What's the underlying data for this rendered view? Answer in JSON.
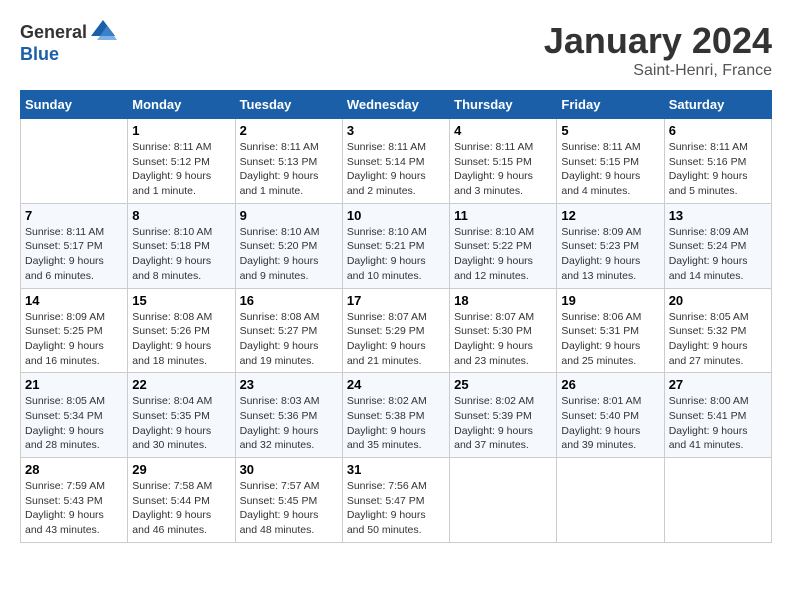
{
  "header": {
    "logo_general": "General",
    "logo_blue": "Blue",
    "month": "January 2024",
    "location": "Saint-Henri, France"
  },
  "days_of_week": [
    "Sunday",
    "Monday",
    "Tuesday",
    "Wednesday",
    "Thursday",
    "Friday",
    "Saturday"
  ],
  "weeks": [
    [
      {
        "day": "",
        "sunrise": "",
        "sunset": "",
        "daylight": ""
      },
      {
        "day": "1",
        "sunrise": "8:11 AM",
        "sunset": "5:12 PM",
        "daylight": "9 hours and 1 minute."
      },
      {
        "day": "2",
        "sunrise": "8:11 AM",
        "sunset": "5:13 PM",
        "daylight": "9 hours and 1 minute."
      },
      {
        "day": "3",
        "sunrise": "8:11 AM",
        "sunset": "5:14 PM",
        "daylight": "9 hours and 2 minutes."
      },
      {
        "day": "4",
        "sunrise": "8:11 AM",
        "sunset": "5:15 PM",
        "daylight": "9 hours and 3 minutes."
      },
      {
        "day": "5",
        "sunrise": "8:11 AM",
        "sunset": "5:15 PM",
        "daylight": "9 hours and 4 minutes."
      },
      {
        "day": "6",
        "sunrise": "8:11 AM",
        "sunset": "5:16 PM",
        "daylight": "9 hours and 5 minutes."
      }
    ],
    [
      {
        "day": "7",
        "sunrise": "8:11 AM",
        "sunset": "5:17 PM",
        "daylight": "9 hours and 6 minutes."
      },
      {
        "day": "8",
        "sunrise": "8:10 AM",
        "sunset": "5:18 PM",
        "daylight": "9 hours and 8 minutes."
      },
      {
        "day": "9",
        "sunrise": "8:10 AM",
        "sunset": "5:20 PM",
        "daylight": "9 hours and 9 minutes."
      },
      {
        "day": "10",
        "sunrise": "8:10 AM",
        "sunset": "5:21 PM",
        "daylight": "9 hours and 10 minutes."
      },
      {
        "day": "11",
        "sunrise": "8:10 AM",
        "sunset": "5:22 PM",
        "daylight": "9 hours and 12 minutes."
      },
      {
        "day": "12",
        "sunrise": "8:09 AM",
        "sunset": "5:23 PM",
        "daylight": "9 hours and 13 minutes."
      },
      {
        "day": "13",
        "sunrise": "8:09 AM",
        "sunset": "5:24 PM",
        "daylight": "9 hours and 14 minutes."
      }
    ],
    [
      {
        "day": "14",
        "sunrise": "8:09 AM",
        "sunset": "5:25 PM",
        "daylight": "9 hours and 16 minutes."
      },
      {
        "day": "15",
        "sunrise": "8:08 AM",
        "sunset": "5:26 PM",
        "daylight": "9 hours and 18 minutes."
      },
      {
        "day": "16",
        "sunrise": "8:08 AM",
        "sunset": "5:27 PM",
        "daylight": "9 hours and 19 minutes."
      },
      {
        "day": "17",
        "sunrise": "8:07 AM",
        "sunset": "5:29 PM",
        "daylight": "9 hours and 21 minutes."
      },
      {
        "day": "18",
        "sunrise": "8:07 AM",
        "sunset": "5:30 PM",
        "daylight": "9 hours and 23 minutes."
      },
      {
        "day": "19",
        "sunrise": "8:06 AM",
        "sunset": "5:31 PM",
        "daylight": "9 hours and 25 minutes."
      },
      {
        "day": "20",
        "sunrise": "8:05 AM",
        "sunset": "5:32 PM",
        "daylight": "9 hours and 27 minutes."
      }
    ],
    [
      {
        "day": "21",
        "sunrise": "8:05 AM",
        "sunset": "5:34 PM",
        "daylight": "9 hours and 28 minutes."
      },
      {
        "day": "22",
        "sunrise": "8:04 AM",
        "sunset": "5:35 PM",
        "daylight": "9 hours and 30 minutes."
      },
      {
        "day": "23",
        "sunrise": "8:03 AM",
        "sunset": "5:36 PM",
        "daylight": "9 hours and 32 minutes."
      },
      {
        "day": "24",
        "sunrise": "8:02 AM",
        "sunset": "5:38 PM",
        "daylight": "9 hours and 35 minutes."
      },
      {
        "day": "25",
        "sunrise": "8:02 AM",
        "sunset": "5:39 PM",
        "daylight": "9 hours and 37 minutes."
      },
      {
        "day": "26",
        "sunrise": "8:01 AM",
        "sunset": "5:40 PM",
        "daylight": "9 hours and 39 minutes."
      },
      {
        "day": "27",
        "sunrise": "8:00 AM",
        "sunset": "5:41 PM",
        "daylight": "9 hours and 41 minutes."
      }
    ],
    [
      {
        "day": "28",
        "sunrise": "7:59 AM",
        "sunset": "5:43 PM",
        "daylight": "9 hours and 43 minutes."
      },
      {
        "day": "29",
        "sunrise": "7:58 AM",
        "sunset": "5:44 PM",
        "daylight": "9 hours and 46 minutes."
      },
      {
        "day": "30",
        "sunrise": "7:57 AM",
        "sunset": "5:45 PM",
        "daylight": "9 hours and 48 minutes."
      },
      {
        "day": "31",
        "sunrise": "7:56 AM",
        "sunset": "5:47 PM",
        "daylight": "9 hours and 50 minutes."
      },
      {
        "day": "",
        "sunrise": "",
        "sunset": "",
        "daylight": ""
      },
      {
        "day": "",
        "sunrise": "",
        "sunset": "",
        "daylight": ""
      },
      {
        "day": "",
        "sunrise": "",
        "sunset": "",
        "daylight": ""
      }
    ]
  ]
}
